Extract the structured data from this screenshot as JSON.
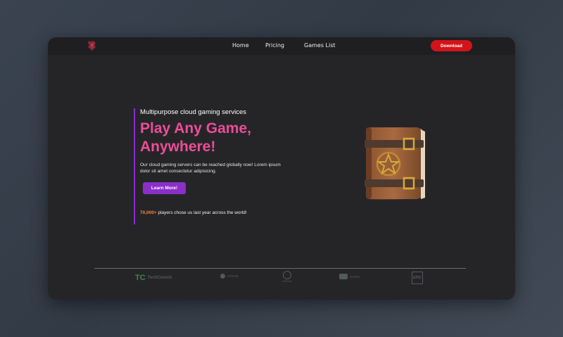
{
  "nav": {
    "links": [
      "Home",
      "Pricing",
      "Games List"
    ],
    "download_label": "Download"
  },
  "hero": {
    "subtitle": "Multipurpose cloud gaming services",
    "headline_line1": "Play Any Game,",
    "headline_line2": "Anywhere!",
    "description": "Our cloud gaming servers can be reached globally now! Lorem ipsum dolor sit amet consectetur adipisicing.",
    "cta_label": "Learn More!",
    "stats_number": "70,000+",
    "stats_text": " players chose us last year across the world!"
  },
  "partners": {
    "techcrunch": "TechCrunch",
    "steam": "STEAM",
    "unreal": "UNREAL",
    "nvidia": "NVIDIA",
    "epic": "EPIC"
  },
  "colors": {
    "accent_pink": "#ec4d96",
    "accent_purple": "#8b2fc9",
    "download_red": "#d2141a",
    "stats_orange": "#f08a3a"
  },
  "icons": [
    "brand-logo-icon",
    "spellbook-illustration",
    "techcrunch-logo",
    "steam-logo",
    "unreal-logo",
    "nvidia-logo",
    "epic-games-logo"
  ]
}
